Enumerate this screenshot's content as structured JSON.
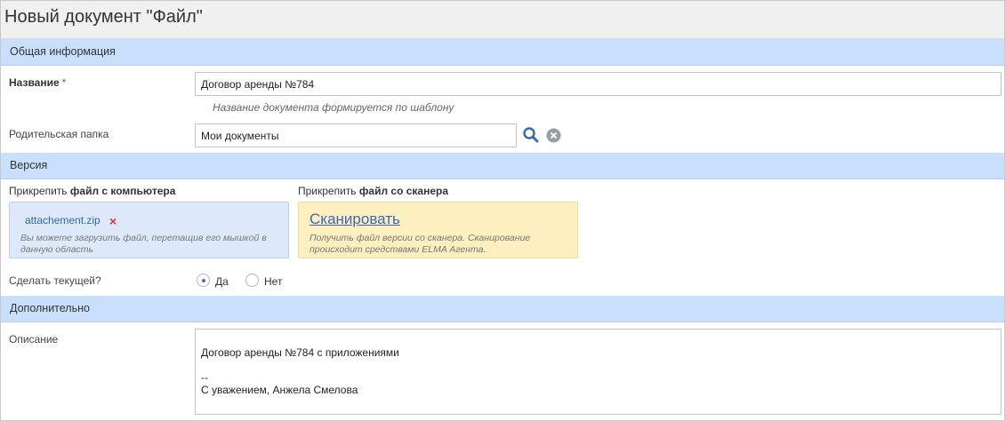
{
  "title": "Новый документ \"Файл\"",
  "sections": {
    "general": "Общая информация",
    "version": "Версия",
    "additional": "Дополнительно"
  },
  "fields": {
    "name": {
      "label": "Название",
      "required_mark": "*",
      "value": "Договор аренды №784",
      "hint": "Название документа формируется по шаблону"
    },
    "parent_folder": {
      "label": "Родительская папка",
      "value": "Мои документы"
    },
    "attach_computer": {
      "label_prefix": "Прикрепить ",
      "label_bold": "файл с компьютера",
      "file_name": "attachement.zip",
      "remove_icon": "×",
      "hint": "Вы можете загрузить файл, перетащив его мышкой в данную область"
    },
    "attach_scanner": {
      "label_prefix": "Прикрепить ",
      "label_bold": "файл со сканера",
      "link": "Сканировать",
      "hint": "Получить файл версии со сканера. Сканирование происходит средствами ELMA Агента."
    },
    "make_current": {
      "label": "Сделать текущей?",
      "options": [
        "Да",
        "Нет"
      ],
      "selected": "Да"
    },
    "description": {
      "label": "Описание",
      "lines": [
        "",
        "Договор аренды №784 с приложениями",
        "",
        "--",
        "С уважением, Анжела Смелова"
      ]
    }
  },
  "icons": {
    "search": "search-icon",
    "clear": "clear-icon"
  },
  "colors": {
    "section_bg": "#c9dffb",
    "drop_zone_bg": "#dde9fb",
    "scan_zone_bg": "#fdefbf",
    "required": "#d9343a",
    "link": "#3a67b8"
  }
}
